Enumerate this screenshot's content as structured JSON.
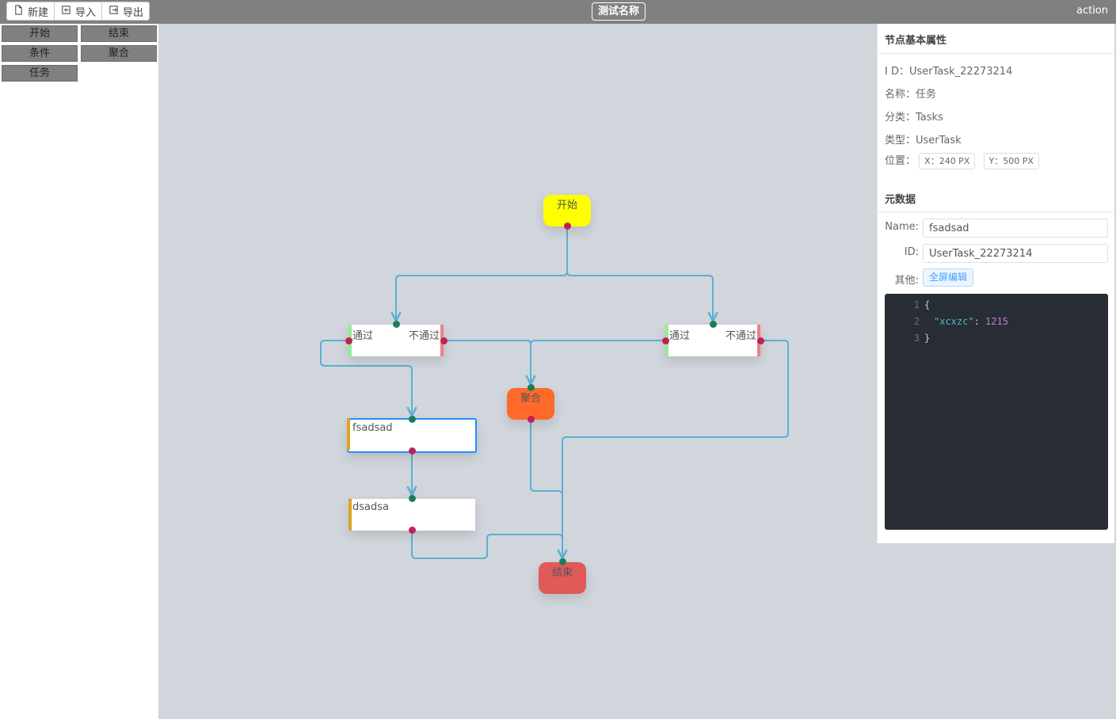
{
  "toolbar": {
    "new_label": "新建",
    "import_label": "导入",
    "export_label": "导出",
    "title": "测试名称",
    "action_label": "action"
  },
  "palette": {
    "items": [
      "开始",
      "结束",
      "条件",
      "聚合",
      "任务"
    ]
  },
  "nodes": {
    "start": "开始",
    "cond_left_pass": "通过",
    "cond_left_fail": "不通过",
    "cond_right_pass": "通过",
    "cond_right_fail": "不通过",
    "merge": "聚合",
    "task1": "fsadsad",
    "task2": "dsadsa",
    "end": "结束"
  },
  "colors": {
    "start": "#ffff00",
    "merge": "#ff6a2a",
    "end": "#e05a5a",
    "edge": "#5ab0d2",
    "pass_bar": "#90ee90",
    "fail_bar": "#f08080",
    "task_bar": "#daa520"
  },
  "panel": {
    "basic_title": "节点基本属性",
    "id_row": "I D：UserTask_22273214",
    "name_row": "名称：任务",
    "category_row": "分类：Tasks",
    "type_row": "类型：UserTask",
    "position_label": "位置：",
    "pos_x": "X：240 PX",
    "pos_y": "Y：500 PX",
    "meta_title": "元数据",
    "name_label": "Name:",
    "name_value": "fsadsad",
    "id_label": "ID:",
    "id_value": "UserTask_22273214",
    "other_label": "其他:",
    "fullscreen_label": "全屏编辑",
    "editor": {
      "line_numbers": [
        "1",
        "2",
        "3"
      ],
      "line1": "{",
      "key": "\"xcxzc\"",
      "colon": ": ",
      "value": "1215",
      "line3": "}"
    }
  }
}
